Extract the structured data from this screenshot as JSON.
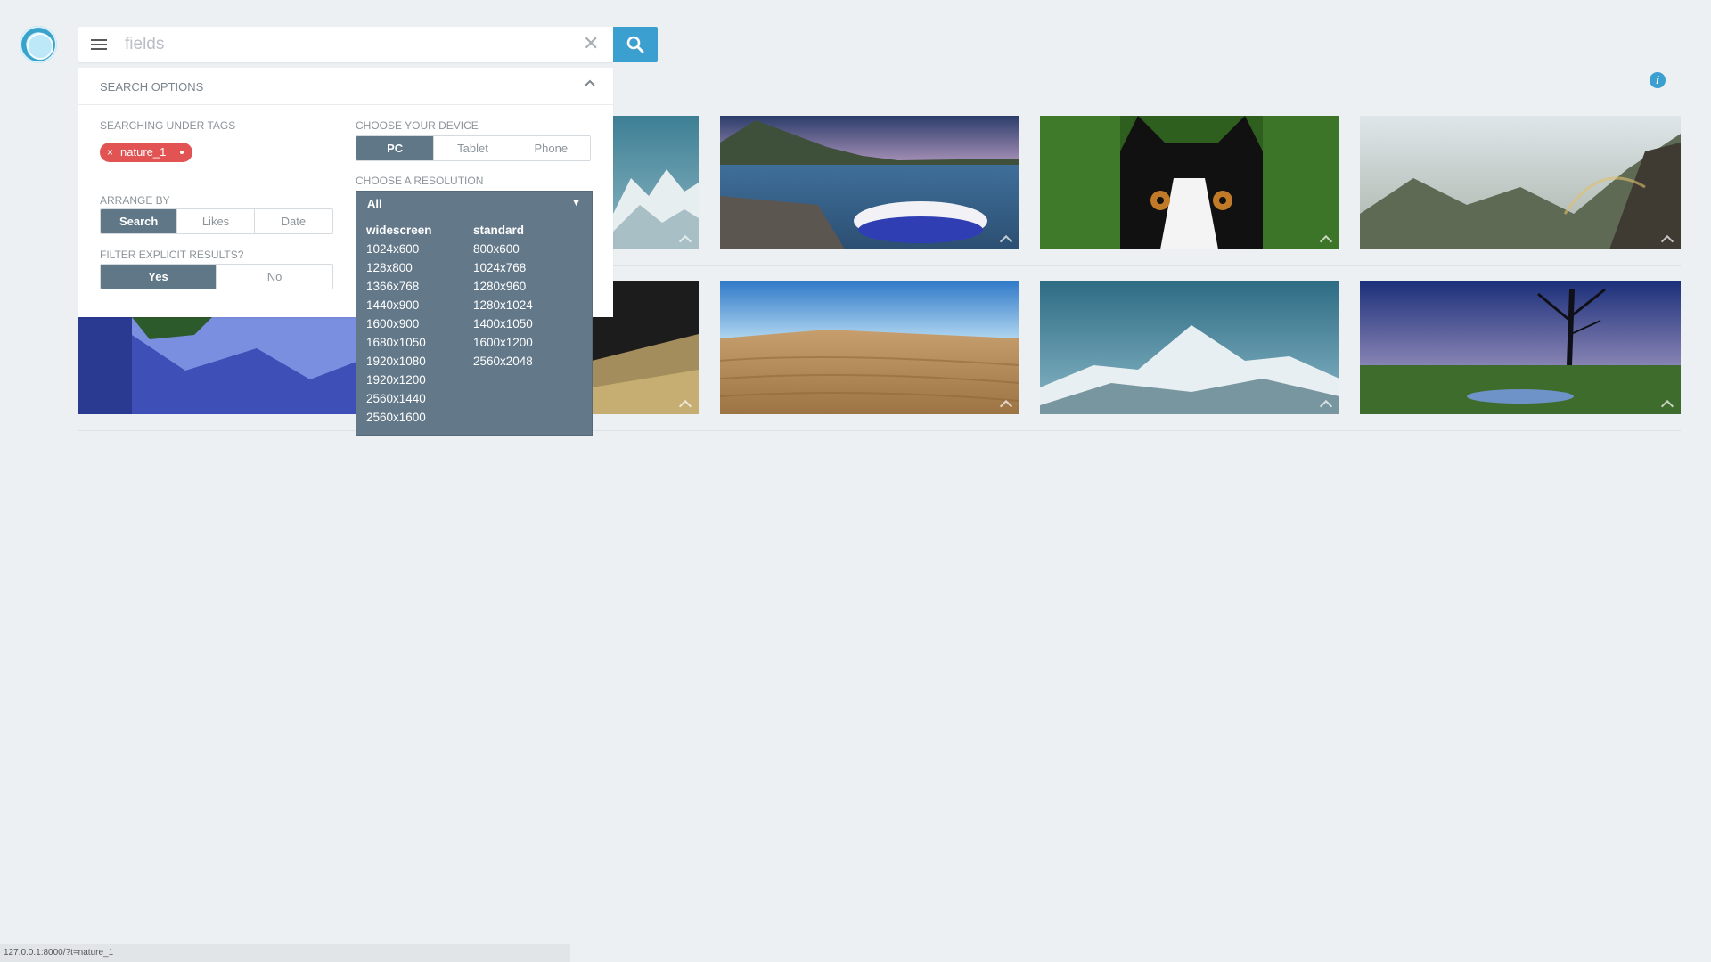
{
  "search": {
    "value": "fields",
    "placeholder": "fields"
  },
  "options": {
    "title": "SEARCH OPTIONS",
    "tags_label": "SEARCHING UNDER TAGS",
    "tag": {
      "remove": "×",
      "label": "nature_1"
    },
    "arrange_label": "ARRANGE BY",
    "arrange": [
      "Search",
      "Likes",
      "Date"
    ],
    "arrange_selected": "Search",
    "filter_label": "FILTER EXPLICIT RESULTS?",
    "filter": [
      "Yes",
      "No"
    ],
    "filter_selected": "Yes",
    "device_label": "CHOOSE YOUR DEVICE",
    "device": [
      "PC",
      "Tablet",
      "Phone"
    ],
    "device_selected": "PC",
    "resolution_label": "CHOOSE A RESOLUTION",
    "resolution_selected": "All",
    "resolution_caret": "▼",
    "widescreen": {
      "head": "widescreen",
      "items": [
        "1024x600",
        "128x800",
        "1366x768",
        "1440x900",
        "1600x900",
        "1680x1050",
        "1920x1080",
        "1920x1200",
        "2560x1440",
        "2560x1600"
      ]
    },
    "standard": {
      "head": "standard",
      "items": [
        "800x600",
        "1024x768",
        "1280x960",
        "1280x1024",
        "1400x1050",
        "1600x1200",
        "2560x2048"
      ]
    }
  },
  "images": [
    {
      "name": "mountains-snow-1"
    },
    {
      "name": "boat-lake"
    },
    {
      "name": "cat"
    },
    {
      "name": "misty-mountains-rainbow"
    },
    {
      "name": "blue-fantasy-valley"
    },
    {
      "name": "wheat-field"
    },
    {
      "name": "sand-dunes"
    },
    {
      "name": "snowy-peaks"
    },
    {
      "name": "dead-tree-swamp"
    }
  ],
  "status": {
    "url": "127.0.0.1:8000/?t=nature_1"
  },
  "colors": {
    "accent": "#3b9fd0",
    "tag": "#e25353",
    "segment_active": "#5f7787",
    "dropdown": "#637888",
    "background": "#edf0f2"
  }
}
